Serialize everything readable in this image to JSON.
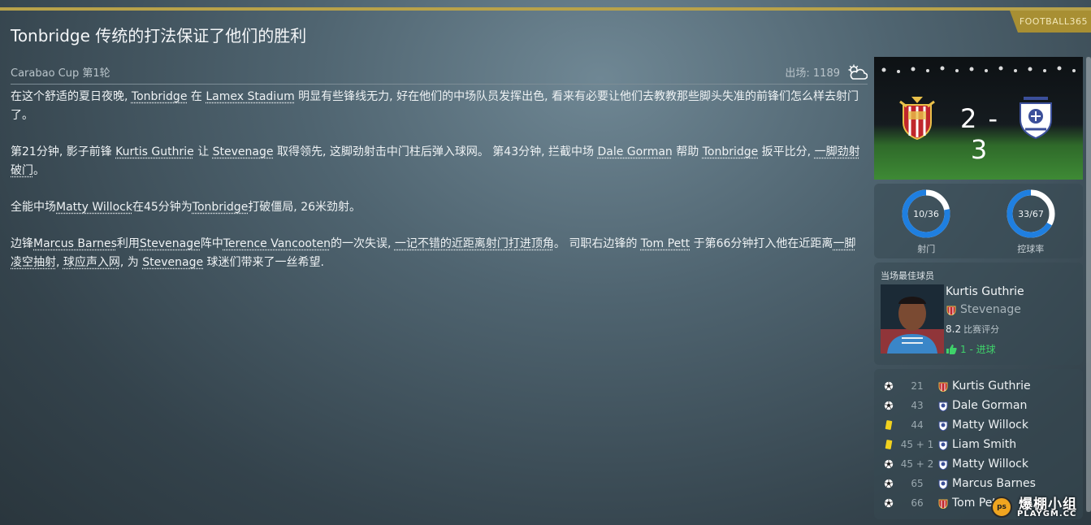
{
  "brand": "FOOTBALL365",
  "headline": "Tonbridge 传统的打法保证了他们的胜利",
  "competition": "Carabao Cup 第1轮",
  "attendance": "出场: 1189",
  "weather_icon": "partly-cloudy-icon",
  "article": {
    "p1": {
      "a": "在这个舒适的夏日夜晚, ",
      "home": "Tonbridge",
      "b": " 在 ",
      "stadium": "Lamex Stadium",
      "c": " 明显有些锋线无力, 好在他们的中场队员发挥出色, 看来有必要让他们去教教那些脚头失准的前锋们怎么样去射门了。"
    },
    "p2": {
      "a": "第21分钟, 影子前锋 ",
      "p1": "Kurtis Guthrie",
      "b": " 让 ",
      "t1": "Stevenage",
      "c": " 取得领先, 这脚劲射击中门柱后弹入球网。 第43分钟, 拦截中场 ",
      "p2": "Dale Gorman",
      "d": " 帮助 ",
      "t2": "Tonbridge",
      "e": " 扳平比分, ",
      "f": "一脚劲射破门",
      "g": "。"
    },
    "p3": {
      "a": "全能中场",
      "p1": "Matty Willock",
      "b": "在45分钟为",
      "t1": "Tonbridge",
      "c": "打破僵局, 26米劲射。"
    },
    "p4": {
      "a": "边锋",
      "p1": "Marcus Barnes",
      "b": "利用",
      "t1": "Stevenage",
      "c": "阵中",
      "p2": "Terence Vancooten",
      "d": "的一次失误, ",
      "e": "一记不错的近距离射门打进顶角",
      "f": "。 司职右边锋的 ",
      "p3": "Tom Pett",
      "g": " 于第66分钟打入他在近距离",
      "h": "一脚凌空抽射",
      "i": ", ",
      "j": "球应声入网",
      "k": ", 为 ",
      "t2": "Stevenage",
      "l": " 球迷们带来了一丝希望."
    }
  },
  "match": {
    "home_score": "2",
    "away_score": "3",
    "score_text": "2 - 3",
    "home_crest_icon": "stevenage-crest-icon",
    "away_crest_icon": "tonbridge-crest-icon"
  },
  "stats": [
    {
      "value_text": "10/36",
      "label": "射门",
      "home": 10,
      "away": 36,
      "home_color": "#1f7fe0",
      "track_color": "#ffffff"
    },
    {
      "value_text": "33/67",
      "label": "控球率",
      "home": 33,
      "away": 67,
      "home_color": "#1f7fe0",
      "track_color": "#ffffff"
    }
  ],
  "potm": {
    "title": "当场最佳球员",
    "name": "Kurtis Guthrie",
    "team": "Stevenage",
    "rating": "8.2",
    "rating_label": "比赛评分",
    "goals": "1 - 进球",
    "goals_icon": "thumbs-up-icon"
  },
  "events": [
    {
      "icon": "goal-ball-icon",
      "minute": "21",
      "crest": "stevenage-crest-icon",
      "player": "Kurtis Guthrie"
    },
    {
      "icon": "goal-ball-icon",
      "minute": "43",
      "crest": "tonbridge-crest-icon",
      "player": "Dale Gorman"
    },
    {
      "icon": "yellow-card-icon",
      "minute": "44",
      "crest": "tonbridge-crest-icon",
      "player": "Matty Willock"
    },
    {
      "icon": "yellow-card-icon",
      "minute": "45 + 1",
      "crest": "tonbridge-crest-icon",
      "player": "Liam Smith"
    },
    {
      "icon": "goal-ball-icon",
      "minute": "45 + 2",
      "crest": "tonbridge-crest-icon",
      "player": "Matty Willock"
    },
    {
      "icon": "goal-ball-icon",
      "minute": "65",
      "crest": "tonbridge-crest-icon",
      "player": "Marcus Barnes"
    },
    {
      "icon": "goal-ball-icon",
      "minute": "66",
      "crest": "stevenage-crest-icon",
      "player": "Tom Pett"
    }
  ],
  "watermark": {
    "logo": "ps",
    "cn": "爆棚小组",
    "en": "PLAYGM.CC"
  },
  "colors": {
    "accent_gold": "#b8a24a",
    "goal_green": "#3fd26a",
    "donut_blue": "#1f7fe0"
  }
}
